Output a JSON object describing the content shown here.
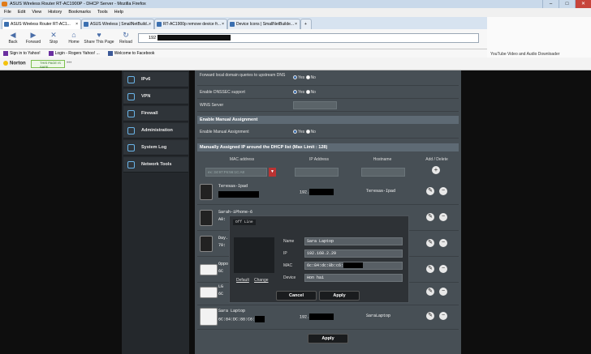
{
  "window": {
    "title": "ASUS Wireless Router RT-AC1900P - DHCP Server - Mozilla Firefox"
  },
  "menu": [
    "File",
    "Edit",
    "View",
    "History",
    "Bookmarks",
    "Tools",
    "Help"
  ],
  "tabs": [
    {
      "label": "ASUS Wireless Router RT-AC1..."
    },
    {
      "label": "ASUS Wireless | SmallNetBuild..."
    },
    {
      "label": "RT-AC1900p remove device fr..."
    },
    {
      "label": "Device Icons | SmallNetBuilde..."
    }
  ],
  "nav": {
    "back": "Back",
    "forward": "Forward",
    "stop": "Stop",
    "home": "Home",
    "share": "Share This Page",
    "reload": "Reload",
    "url": "192"
  },
  "banner_caption": "YouTube Video and Audio Downloader",
  "bookmarks": [
    "Sign in to Yahoo!",
    "Login - Rogers Yahoo! ...",
    "Welcome to Facebook"
  ],
  "norton": {
    "name": "Norton",
    "safe_label": "THIS PAGE IS",
    "safe_state": "SAFE",
    "more": "•••"
  },
  "sidebar": [
    {
      "label": "IPv6",
      "icon": "ipv6-icon"
    },
    {
      "label": "VPN",
      "icon": "vpn-icon"
    },
    {
      "label": "Firewall",
      "icon": "firewall-icon"
    },
    {
      "label": "Administration",
      "icon": "admin-icon"
    },
    {
      "label": "System Log",
      "icon": "log-icon"
    },
    {
      "label": "Network Tools",
      "icon": "tools-icon"
    }
  ],
  "settings": {
    "forward_local": "Forward local domain queries to upstream DNS",
    "dnssec": "Enable DNSSEC support",
    "wins": "WINS Server",
    "yes": "Yes",
    "no": "No"
  },
  "manual": {
    "section_title": "Enable Manual Assignment",
    "enable_label": "Enable Manual Assignment",
    "list_title": "Manually Assigned IP around the DHCP list (Max Limit : 128)",
    "col_mac": "MAC address",
    "col_ip": "IP Address",
    "col_host": "Hostname",
    "col_action": "Add / Delete",
    "mac_placeholder": "ex: 34:97:F6:56:1C:A8"
  },
  "devices": [
    {
      "name": "Teresas-Ipad",
      "mac": "",
      "ip": "192.",
      "host": "Teresas-Ipad"
    },
    {
      "name": "Sarah-iPhone-6",
      "mac": "A0:",
      "ip": "",
      "host": ""
    },
    {
      "name": "Day...",
      "mac": "70:",
      "ip": "",
      "host": ""
    },
    {
      "name": "Oppo",
      "mac": "6C",
      "ip": "",
      "host": ""
    },
    {
      "name": "LG",
      "mac": "6C",
      "ip": "",
      "host": ""
    },
    {
      "name": "Sara Laptop",
      "mac": "6C:84:DC:88:C6:",
      "ip": "192.",
      "host": "SaraLaptop"
    }
  ],
  "modal": {
    "title": "Off Line",
    "default": "Default",
    "change": "Change",
    "name_label": "Name",
    "name_value": "Sara Laptop",
    "ip_label": "IP",
    "ip_value": "192.168.2.29",
    "mac_label": "MAC",
    "mac_value": "6c:84:dc:8b:c6:",
    "device_label": "Device",
    "device_value": "Hon hai",
    "cancel": "Cancel",
    "apply": "Apply"
  },
  "apply_main": "Apply"
}
